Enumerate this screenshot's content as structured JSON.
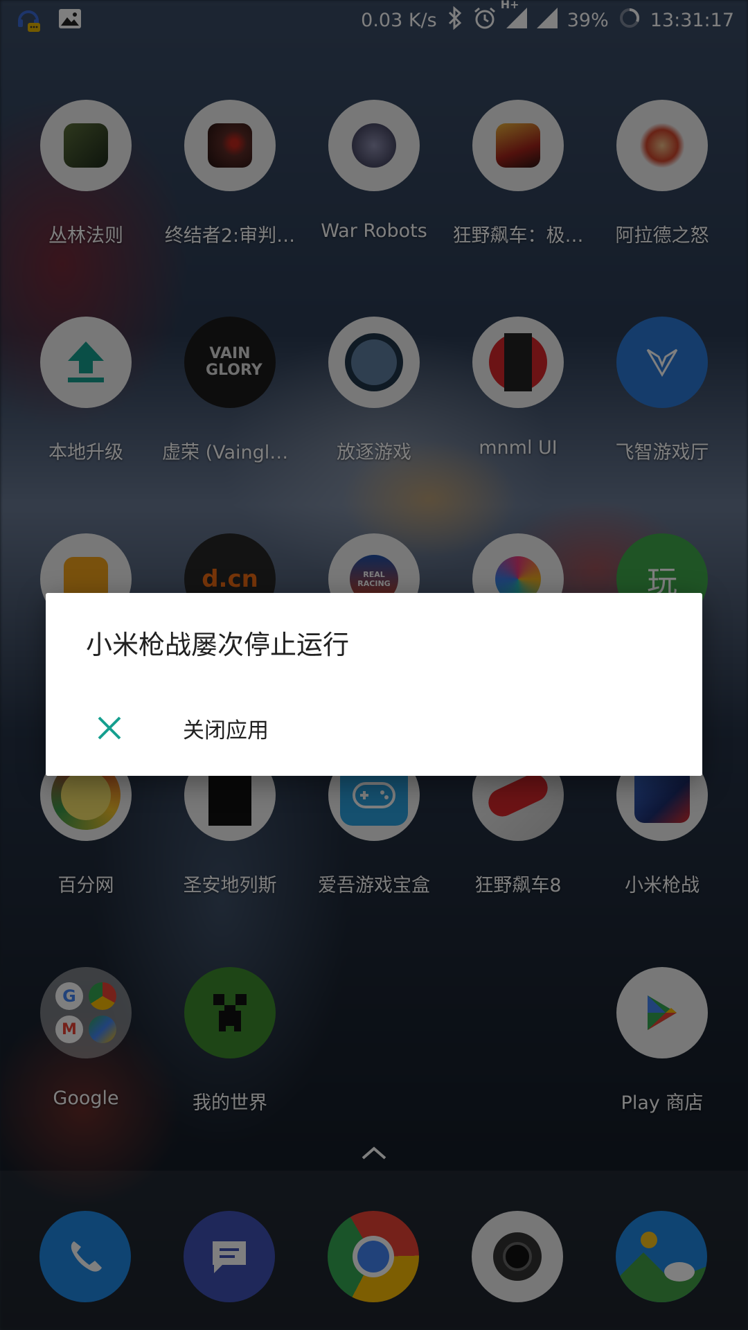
{
  "status_bar": {
    "net_speed": "0.03 K/s",
    "network_type": "H+",
    "battery": "39%",
    "time": "13:31:17"
  },
  "apps": [
    {
      "label": "丛林法则",
      "icon": "jungle-law-icon"
    },
    {
      "label": "终结者2:审判…",
      "icon": "terminator-icon"
    },
    {
      "label": "War Robots",
      "icon": "war-robots-icon"
    },
    {
      "label": "狂野飙车：极…",
      "icon": "asphalt-xtreme-icon"
    },
    {
      "label": "阿拉德之怒",
      "icon": "arad-icon"
    },
    {
      "label": "本地升级",
      "icon": "upload-arrow-icon"
    },
    {
      "label": "虚荣 (Vainglory)",
      "icon": "vainglory-icon"
    },
    {
      "label": "放逐游戏",
      "icon": "soldier-icon"
    },
    {
      "label": "mnml UI",
      "icon": "mnml-icon"
    },
    {
      "label": "飞智游戏厅",
      "icon": "flydigi-icon"
    },
    {
      "label": "百分网",
      "icon": "baifen-icon"
    },
    {
      "label": "圣安地列斯",
      "icon": "gta-icon"
    },
    {
      "label": "爱吾游戏宝盒",
      "icon": "gamepad-icon"
    },
    {
      "label": "狂野飙车8",
      "icon": "asphalt8-icon"
    },
    {
      "label": "小米枪战",
      "icon": "mi-shooter-icon"
    },
    {
      "label": "Google",
      "icon": "google-folder-icon"
    },
    {
      "label": "我的世界",
      "icon": "minecraft-icon"
    },
    {
      "label": "Play 商店",
      "icon": "play-store-icon"
    }
  ],
  "partial_icon_text": {
    "dcn": "d.cn",
    "play": "玩",
    "vainglory_logo": "VAIN GLORY",
    "real_racing": "REAL RACING"
  },
  "dock": [
    "phone-icon",
    "messages-icon",
    "chrome-icon",
    "camera-icon",
    "gallery-icon"
  ],
  "dialog": {
    "title": "小米枪战屡次停止运行",
    "option_label": "关闭应用",
    "accent": "#159f8f"
  }
}
